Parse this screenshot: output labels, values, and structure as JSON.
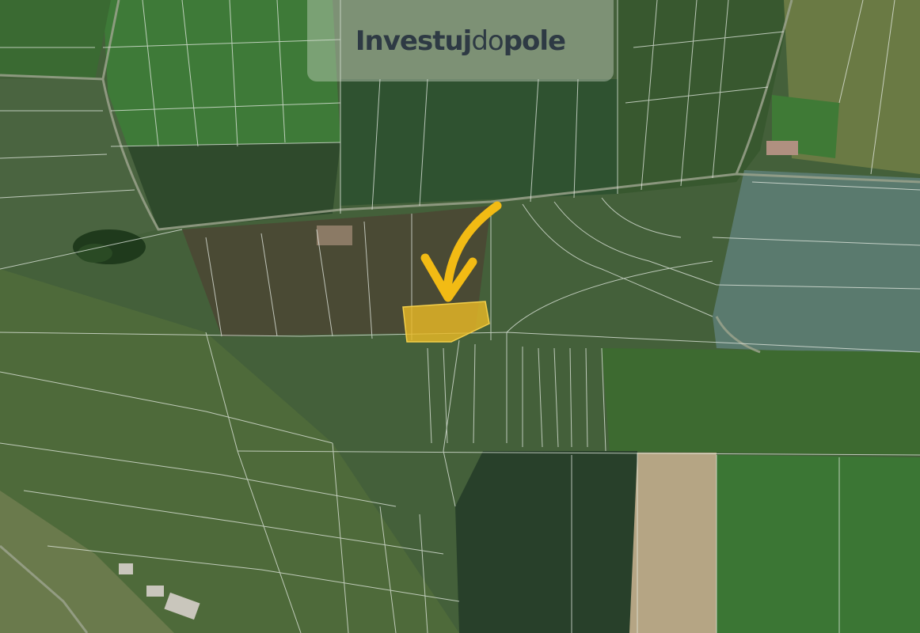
{
  "logo": {
    "part1": "Investuj",
    "part2": "do",
    "part3": "pole"
  },
  "colors": {
    "parcel_highlight": "#e8b826",
    "arrow": "#f2bb14",
    "boundary_lines": "#e6ece4",
    "logo_text": "#2e3a44"
  },
  "icons": {
    "arrow": "pointer-arrow-icon"
  }
}
